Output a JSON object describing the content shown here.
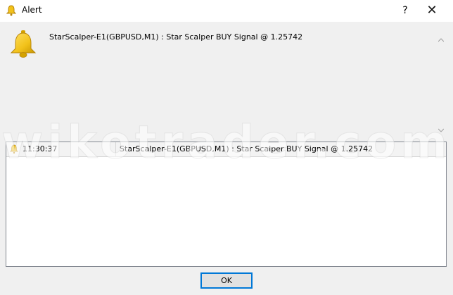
{
  "window": {
    "title": "Alert",
    "help_label": "?",
    "close_label": "✕"
  },
  "message": {
    "text": "StarScalper-E1(GBPUSD,M1) : Star Scalper BUY Signal @ 1.25742"
  },
  "history": {
    "rows": [
      {
        "time": "11:30:37",
        "message": "StarScalper-E1(GBPUSD,M1) : Star Scalper BUY Signal @ 1.25742"
      }
    ]
  },
  "buttons": {
    "ok_label": "OK"
  },
  "watermark": {
    "text": "wikotrader.com"
  },
  "colors": {
    "focus_border": "#0078d7",
    "bell_gold": "#f2c21a"
  },
  "icons": {
    "title": "bell-icon",
    "message": "bell-icon",
    "row": "bell-icon"
  }
}
